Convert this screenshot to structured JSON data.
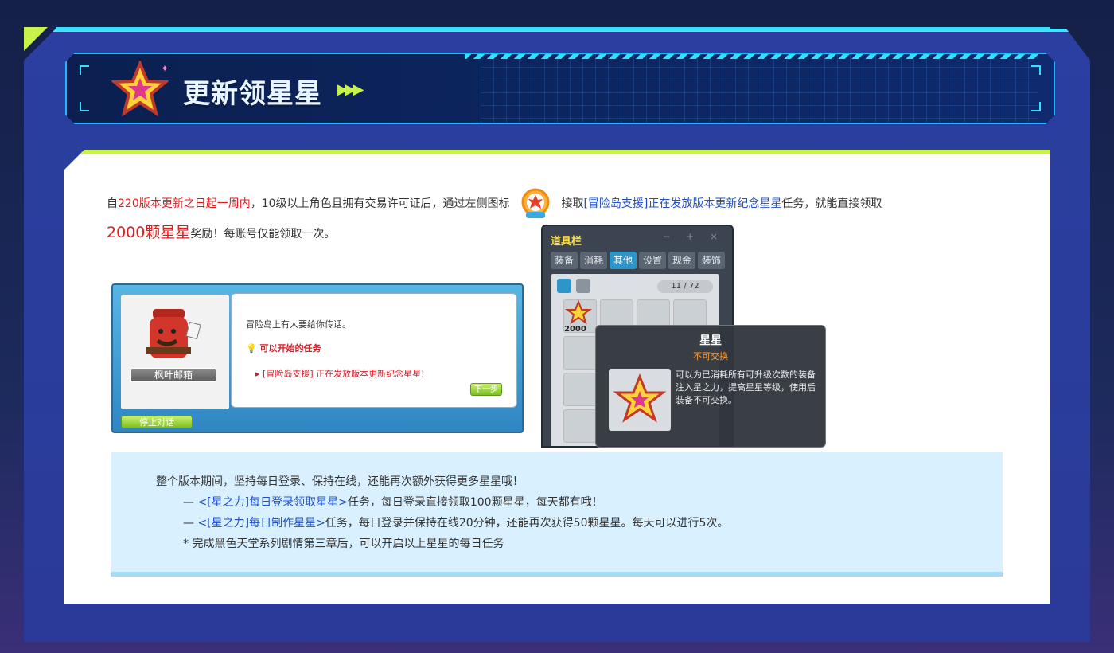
{
  "header": {
    "title": "更新领星星",
    "arrows": "▶▶▶"
  },
  "intro": {
    "p1": "自",
    "red1": "220版本更新之日起一周内",
    "p2": "，10级以上角色且拥有交易许可证后，通过左侧图标",
    "p3": "接取",
    "quest_link": "[冒险岛支援]正在发放版本更新纪念星星",
    "p4": "任务，就能直接领取",
    "reward": "2000颗星星",
    "p5": "奖励！每账号仅能领取一次。"
  },
  "dialog": {
    "npc_name": "枫叶邮箱",
    "line1": "冒险岛上有人要给你传话。",
    "line2": "可以开始的任务",
    "line3": "[冒险岛支援] 正在发放版本更新纪念星星!",
    "next_label": "下一步",
    "stop_label": "停止对话"
  },
  "inventory": {
    "title": "道具栏",
    "controls": "− + ×",
    "tabs": [
      "装备",
      "消耗",
      "其他",
      "设置",
      "现金",
      "装饰"
    ],
    "active_tab": 2,
    "count": "11 / 72",
    "slot_label": "2000"
  },
  "tooltip": {
    "title": "星星",
    "subtitle": "不可交换",
    "description": "可以为已消耗所有可升级次数的装备注入星之力，提高星星等级，使用后装备不可交换。"
  },
  "info": {
    "heading": "整个版本期间，坚持每日登录、保持在线，还能再次额外获得更多星星哦！",
    "row1_prefix": "— ",
    "row1_link": "<[星之力]每日登录领取星星>",
    "row1_text": "任务，每日登录直接领取100颗星星，每天都有哦！",
    "row2_prefix": "— ",
    "row2_link": "<[星之力]每日制作星星>",
    "row2_text": "任务，每日登录并保持在线20分钟，还能再次获得50颗星星。每天可以进行5次。",
    "note": "* 完成黑色天堂系列剧情第三章后，可以开启以上星星的每日任务"
  },
  "colors": {
    "accent_lime": "#c8f24a",
    "accent_cyan": "#33e0ff",
    "highlight_red": "#e01b1b",
    "link_blue": "#1f4fc4"
  }
}
